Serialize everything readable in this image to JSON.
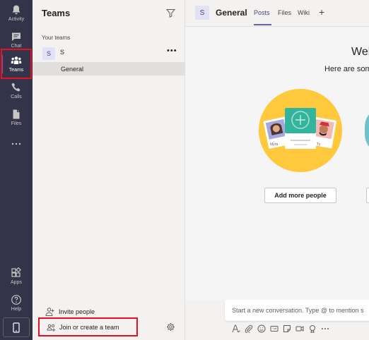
{
  "rail": {
    "items": [
      {
        "label": "Activity",
        "icon": "bell-icon"
      },
      {
        "label": "Chat",
        "icon": "chat-icon"
      },
      {
        "label": "Teams",
        "icon": "teams-icon"
      },
      {
        "label": "Calls",
        "icon": "phone-icon"
      },
      {
        "label": "Files",
        "icon": "file-icon"
      },
      {
        "label": "",
        "icon": "ellipsis-icon"
      },
      {
        "label": "Apps",
        "icon": "apps-icon"
      },
      {
        "label": "Help",
        "icon": "help-icon"
      }
    ],
    "device_icon": "mobile-icon"
  },
  "panel": {
    "title": "Teams",
    "section_label": "Your teams",
    "team": {
      "avatar": "S",
      "name": "S",
      "more": "•••"
    },
    "channel": "General",
    "invite_label": "Invite people",
    "join_label": "Join or create a team"
  },
  "main": {
    "avatar": "S",
    "title": "General",
    "tabs": [
      "Posts",
      "Files",
      "Wiki"
    ],
    "add_tab": "+",
    "welcome": "Wel",
    "subtitle": "Here are som",
    "illustration_names": [
      "Myra",
      "Ty"
    ],
    "add_people_label": "Add more people",
    "compose_placeholder": "Start a new conversation. Type @ to mention s"
  },
  "colors": {
    "rail_bg": "#33344a",
    "accent": "#6264a7",
    "highlight": "#e81123",
    "illus_circle": "#ffc83d",
    "illus_card": "#33b49c"
  }
}
